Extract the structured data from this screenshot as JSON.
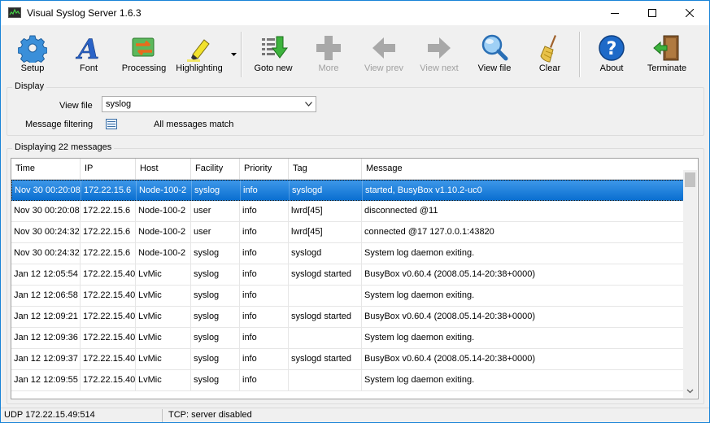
{
  "window": {
    "title": "Visual Syslog Server 1.6.3"
  },
  "toolbar": {
    "setup": "Setup",
    "font": "Font",
    "processing": "Processing",
    "highlighting": "Highlighting",
    "goto_new": "Goto new",
    "more": "More",
    "view_prev": "View prev",
    "view_next": "View next",
    "view_file": "View file",
    "clear": "Clear",
    "about": "About",
    "terminate": "Terminate"
  },
  "display": {
    "group_title": "Display",
    "view_file_label": "View file",
    "view_file_value": "syslog",
    "message_filtering_label": "Message filtering",
    "filter_status": "All messages match"
  },
  "messages": {
    "group_title": "Displaying 22 messages",
    "columns": [
      "Time",
      "IP",
      "Host",
      "Facility",
      "Priority",
      "Tag",
      "Message"
    ],
    "rows": [
      [
        "Nov 30 00:20:08",
        "172.22.15.6",
        "Node-100-2",
        "syslog",
        "info",
        "syslogd",
        "started, BusyBox v1.10.2-uc0"
      ],
      [
        "Nov 30 00:20:08",
        "172.22.15.6",
        "Node-100-2",
        "user",
        "info",
        "lwrd[45]",
        "disconnected @11"
      ],
      [
        "Nov 30 00:24:32",
        "172.22.15.6",
        "Node-100-2",
        "user",
        "info",
        "lwrd[45]",
        "connected @17 127.0.0.1:43820"
      ],
      [
        "Nov 30 00:24:32",
        "172.22.15.6",
        "Node-100-2",
        "syslog",
        "info",
        "syslogd",
        "System log daemon exiting."
      ],
      [
        "Jan 12 12:05:54",
        "172.22.15.40",
        "LvMic",
        "syslog",
        "info",
        "syslogd started",
        "BusyBox v0.60.4 (2008.05.14-20:38+0000)"
      ],
      [
        "Jan 12 12:06:58",
        "172.22.15.40",
        "LvMic",
        "syslog",
        "info",
        "",
        "System log daemon exiting."
      ],
      [
        "Jan 12 12:09:21",
        "172.22.15.40",
        "LvMic",
        "syslog",
        "info",
        "syslogd started",
        "BusyBox v0.60.4 (2008.05.14-20:38+0000)"
      ],
      [
        "Jan 12 12:09:36",
        "172.22.15.40",
        "LvMic",
        "syslog",
        "info",
        "",
        "System log daemon exiting."
      ],
      [
        "Jan 12 12:09:37",
        "172.22.15.40",
        "LvMic",
        "syslog",
        "info",
        "syslogd started",
        "BusyBox v0.60.4 (2008.05.14-20:38+0000)"
      ],
      [
        "Jan 12 12:09:55",
        "172.22.15.40",
        "LvMic",
        "syslog",
        "info",
        "",
        "System log daemon exiting."
      ]
    ]
  },
  "status": {
    "udp": "UDP 172.22.15.49:514",
    "tcp": "TCP: server disabled"
  }
}
